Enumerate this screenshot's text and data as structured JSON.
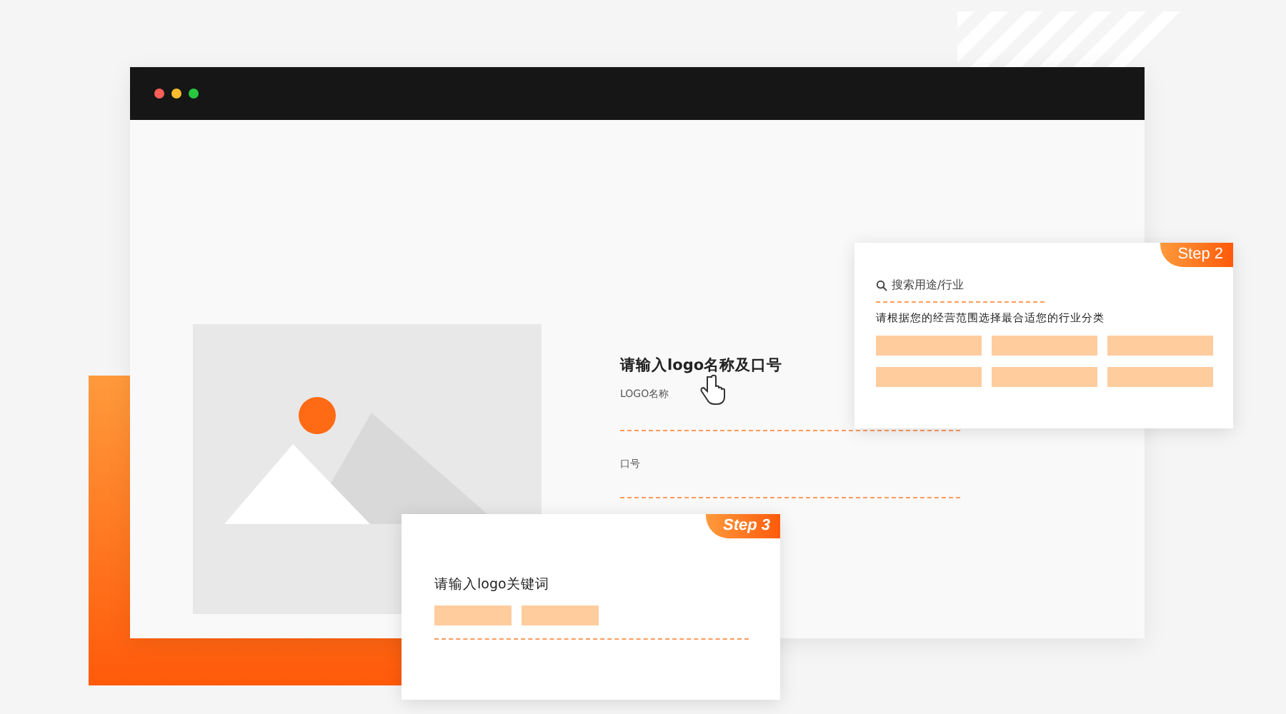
{
  "form": {
    "title": "请输入logo名称及口号",
    "fields": [
      {
        "label": "LOGO名称"
      },
      {
        "label": "口号"
      }
    ]
  },
  "step2": {
    "badge": "Step 2",
    "search": {
      "placeholder": "搜索用途/行业"
    },
    "hint": "请根据您的经营范围选择最合适您的行业分类"
  },
  "step3": {
    "badge": "Step 3",
    "hint": "请输入logo关键词"
  }
}
